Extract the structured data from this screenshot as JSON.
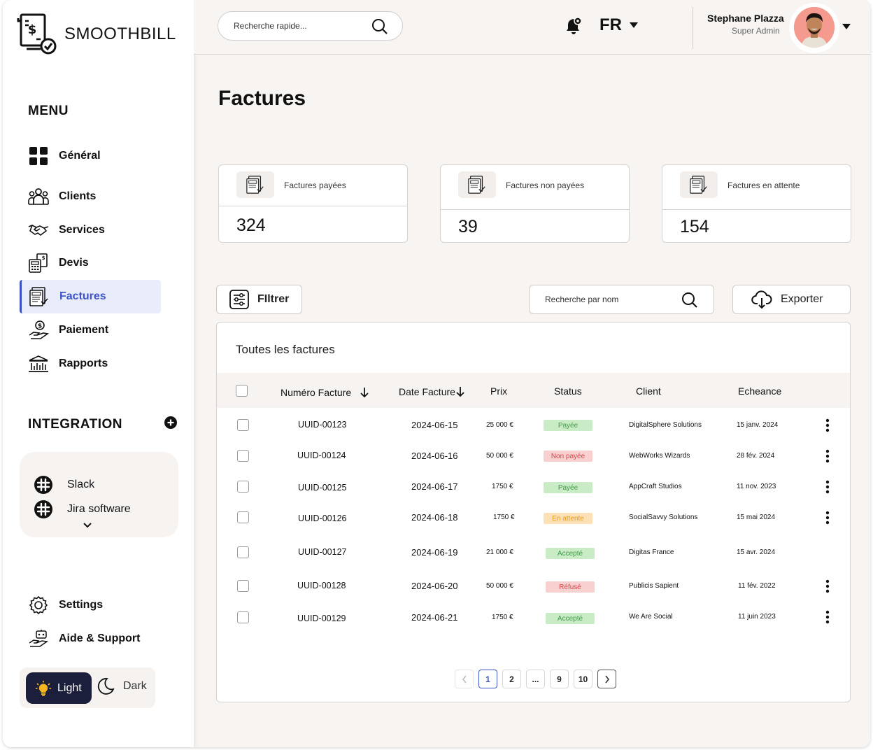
{
  "app": {
    "name": "SMOOTHBILL"
  },
  "sidebar": {
    "menu_title": "MENU",
    "items": [
      {
        "label": "Général",
        "icon": "grid-icon"
      },
      {
        "label": "Clients",
        "icon": "users-icon"
      },
      {
        "label": "Services",
        "icon": "handshake-icon"
      },
      {
        "label": "Devis",
        "icon": "calculator-icon"
      },
      {
        "label": "Factures",
        "icon": "invoice-icon",
        "active": true
      },
      {
        "label": "Paiement",
        "icon": "payment-hand-icon"
      },
      {
        "label": "Rapports",
        "icon": "bank-icon"
      }
    ],
    "integration_title": "INTEGRATION",
    "integrations": [
      {
        "label": "Slack",
        "icon": "slack-icon"
      },
      {
        "label": "Jira software",
        "icon": "jira-icon"
      }
    ],
    "settings_label": "Settings",
    "support_label": "Aide & Support",
    "theme": {
      "light": "Light",
      "dark": "Dark",
      "selected": "Light"
    }
  },
  "header": {
    "search_placeholder": "Recherche rapide...",
    "language": "FR",
    "user": {
      "name": "Stephane Plazza",
      "role": "Super Admin"
    }
  },
  "page": {
    "title": "Factures"
  },
  "stats": [
    {
      "label": "Factures payées",
      "value": "324"
    },
    {
      "label": "Factures non payées",
      "value": "39"
    },
    {
      "label": "Factures en attente",
      "value": "154"
    }
  ],
  "toolbar": {
    "filter_label": "FIltrer",
    "name_search_placeholder": "Recherche par nom",
    "export_label": "Exporter"
  },
  "table": {
    "title": "Toutes les factures",
    "columns": {
      "number": "Numéro Facture",
      "date": "Date Facture",
      "price": "Prix",
      "status": "Status",
      "client": "Client",
      "due": "Echeance"
    },
    "rows": [
      {
        "number": "UUID-00123",
        "date": "2024-06-15",
        "price": "25 000 €",
        "status": "Payée",
        "client": "DigitalSphere Solutions",
        "due": "15 janv. 2024",
        "menu": true
      },
      {
        "number": "UUID-00124",
        "date": "2024-06-16",
        "price": "50 000 €",
        "status": "Non payée",
        "client": "WebWorks Wizards",
        "due": "28 fév. 2024",
        "menu": true
      },
      {
        "number": "UUID-00125",
        "date": "2024-06-17",
        "price": "1750 €",
        "status": "Payée",
        "client": "AppCraft Studios",
        "due": "11 nov. 2023",
        "menu": true
      },
      {
        "number": "UUID-00126",
        "date": "2024-06-18",
        "price": "1750 €",
        "status": "En attente",
        "client": "SocialSavvy Solutions",
        "due": "15 mai 2024",
        "menu": true
      },
      {
        "number": "UUID-00127",
        "date": "2024-06-19",
        "price": "21 000 €",
        "status": "Accepté",
        "client": "Digitas France",
        "due": "15 avr. 2024",
        "menu": false
      },
      {
        "number": "UUID-00128",
        "date": "2024-06-20",
        "price": "50 000 €",
        "status": "Réfusé",
        "client": "Publicis Sapient",
        "due": "11 fév. 2022",
        "menu": true
      },
      {
        "number": "UUID-00129",
        "date": "2024-06-21",
        "price": "1750 €",
        "status": "Accepté",
        "client": "We Are Social",
        "due": "11 juin 2023",
        "menu": true
      }
    ]
  },
  "pagination": {
    "pages": [
      "1",
      "2",
      "...",
      "9",
      "10"
    ],
    "current": "1"
  },
  "colors": {
    "accent": "#3a55c9",
    "active_bg": "#e9ecfb",
    "status_paid_bg": "#c9ecc7",
    "status_paid_fg": "#3f9a46",
    "status_unpaid_bg": "#f8d0d0",
    "status_unpaid_fg": "#d94545",
    "status_pending_bg": "#fde0b5",
    "status_pending_fg": "#e39a1c"
  }
}
